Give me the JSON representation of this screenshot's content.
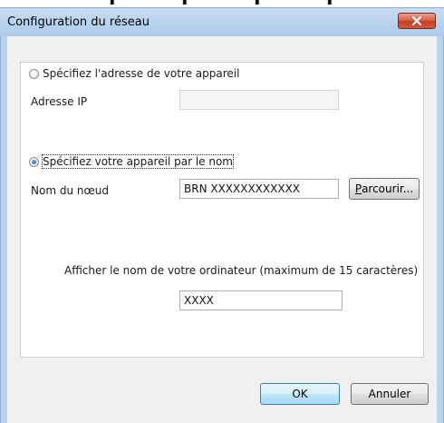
{
  "window": {
    "title": "Configuration du réseau",
    "close_icon": "close-icon"
  },
  "top_fragment": {
    "text": "r   r   r   r"
  },
  "option_address": {
    "label": "Spécifiez l'adresse de votre appareil",
    "selected": false,
    "ip_label": "Adresse IP",
    "ip_value": ""
  },
  "option_name": {
    "label": "Spécifiez votre appareil par le nom",
    "selected": true,
    "node_label": "Nom du nœud",
    "node_value": "BRN XXXXXXXXXXXX",
    "browse_prefix": "P",
    "browse_rest": "arcourir..."
  },
  "computer_name": {
    "label": "Afficher le nom de votre ordinateur (maximum de 15 caractères)",
    "value": "XXXX"
  },
  "buttons": {
    "ok": "OK",
    "cancel": "Annuler"
  }
}
